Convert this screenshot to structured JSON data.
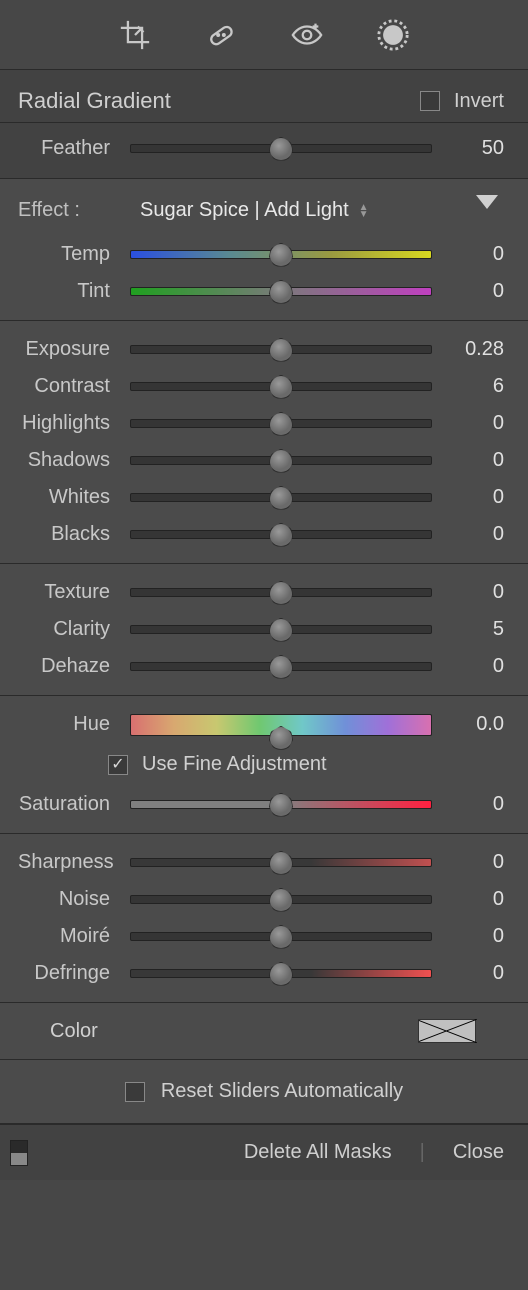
{
  "toolbar": {
    "tools": [
      "crop-icon",
      "heal-icon",
      "redeye-icon",
      "mask-icon"
    ]
  },
  "header": {
    "title": "Radial Gradient",
    "invert_label": "Invert",
    "invert_checked": false
  },
  "feather": {
    "label": "Feather",
    "value": "50"
  },
  "effect": {
    "label": "Effect :",
    "preset": "Sugar Spice | Add Light"
  },
  "collapse": "▼",
  "sections": {
    "wb": [
      {
        "label": "Temp",
        "value": "0",
        "gradient": "gradient-temp"
      },
      {
        "label": "Tint",
        "value": "0",
        "gradient": "gradient-tint"
      }
    ],
    "tone": [
      {
        "label": "Exposure",
        "value": "0.28"
      },
      {
        "label": "Contrast",
        "value": "6"
      },
      {
        "label": "Highlights",
        "value": "0"
      },
      {
        "label": "Shadows",
        "value": "0"
      },
      {
        "label": "Whites",
        "value": "0"
      },
      {
        "label": "Blacks",
        "value": "0"
      }
    ],
    "presence": [
      {
        "label": "Texture",
        "value": "0"
      },
      {
        "label": "Clarity",
        "value": "5"
      },
      {
        "label": "Dehaze",
        "value": "0"
      }
    ],
    "hue": {
      "label": "Hue",
      "value": "0.0",
      "gradient": "gradient-hue"
    },
    "fine_adjust": {
      "label": "Use Fine Adjustment",
      "checked": true
    },
    "saturation": {
      "label": "Saturation",
      "value": "0",
      "gradient": "gradient-sat"
    },
    "detail": [
      {
        "label": "Sharpness",
        "value": "0",
        "gradient": "gradient-sharp"
      },
      {
        "label": "Noise",
        "value": "0"
      },
      {
        "label": "Moiré",
        "value": "0"
      },
      {
        "label": "Defringe",
        "value": "0",
        "gradient": "gradient-defringe"
      }
    ]
  },
  "color_row": {
    "label": "Color"
  },
  "reset_row": {
    "label": "Reset Sliders Automatically",
    "checked": false
  },
  "footer": {
    "delete": "Delete All Masks",
    "close": "Close"
  }
}
